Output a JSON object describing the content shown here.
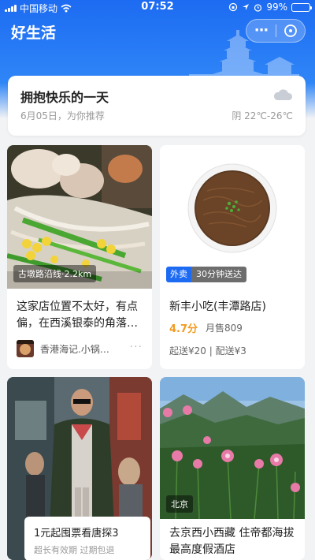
{
  "status_bar": {
    "carrier": "中国移动",
    "time": "07:52",
    "battery": "99%",
    "battery_level": 0.99
  },
  "nav": {
    "title": "好生活",
    "more_label": "···"
  },
  "weather": {
    "title": "拥抱快乐的一天",
    "subtitle": "6月05日，为你推荐",
    "forecast": "阴 22℃-26℃",
    "icon": "cloud-icon"
  },
  "cards": [
    {
      "tag": "古墩路沿线·2.2km",
      "title": "这家店位置不太好，有点偏，在西溪银泰的角落…",
      "shop": "香港海记.小锅…",
      "more": "···"
    },
    {
      "badge_type": "外卖",
      "badge_time": "30分钟送达",
      "title": "新丰小吃(丰潭路店)",
      "rating": "4.7分",
      "sales": "月售809",
      "delivery": "起送¥20 | 配送¥3"
    },
    {
      "title": "1元起囤票看唐探3",
      "subtitle": "超长有效期 过期包退"
    },
    {
      "tag": "北京",
      "title": "去京西小西藏 住帝都海拔最高度假酒店"
    }
  ],
  "colors": {
    "brand_blue": "#1d6bf2",
    "rating_orange": "#f39a1f"
  }
}
